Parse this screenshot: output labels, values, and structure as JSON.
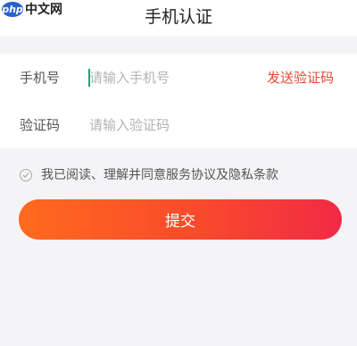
{
  "watermark": {
    "badge": "php",
    "text": "中文网"
  },
  "header": {
    "title": "手机认证"
  },
  "form": {
    "phone": {
      "label": "手机号",
      "placeholder": "请输入手机号",
      "value": ""
    },
    "send_code_label": "发送验证码",
    "code": {
      "label": "验证码",
      "placeholder": "请输入验证码",
      "value": ""
    }
  },
  "agreement": {
    "text": "我已阅读、理解并同意服务协议及隐私条款",
    "checked": false
  },
  "submit_label": "提交",
  "colors": {
    "accent_text": "#e24b36",
    "button_gradient_start": "#ff6a1e",
    "button_gradient_end": "#f22a45",
    "caret": "#1aa37a"
  }
}
